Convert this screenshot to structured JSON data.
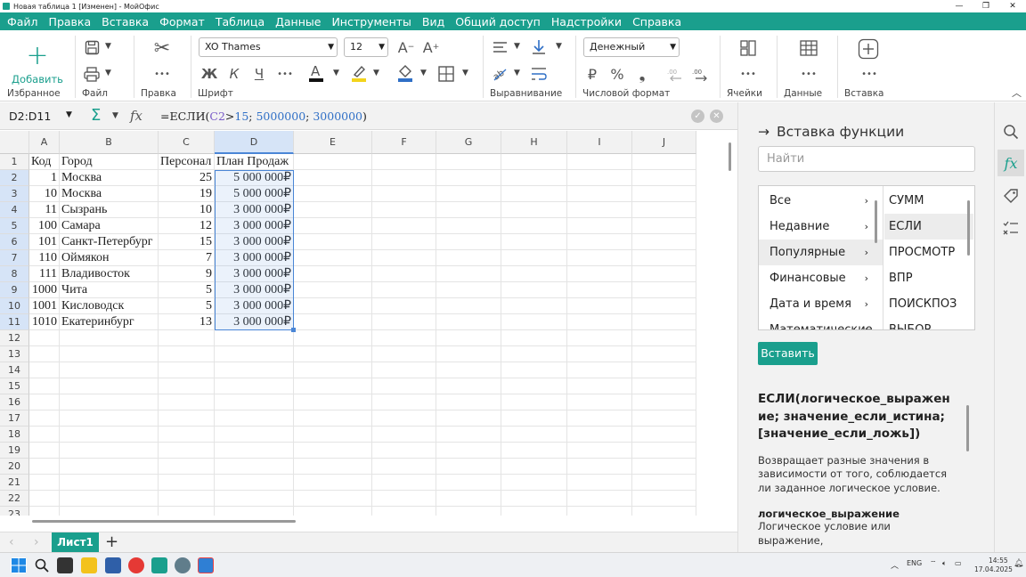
{
  "window": {
    "title": "Новая таблица 1 [Изменен] - МойОфис",
    "controls": [
      "—",
      "❐",
      "✕"
    ]
  },
  "menu": [
    "Файл",
    "Правка",
    "Вставка",
    "Формат",
    "Таблица",
    "Данные",
    "Инструменты",
    "Вид",
    "Общий доступ",
    "Надстройки",
    "Справка"
  ],
  "ribbon": {
    "add_label": "Добавить",
    "groups": {
      "favorites": "Избранное",
      "file": "Файл",
      "edit": "Правка",
      "font": "Шрифт",
      "align": "Выравнивание",
      "numfmt": "Числовой формат",
      "cells": "Ячейки",
      "data": "Данные",
      "insert": "Вставка"
    },
    "font_name": "XO Thames",
    "font_size": "12",
    "number_format": "Денежный",
    "bold_glyph": "Ж",
    "italic_glyph": "К",
    "underline_glyph": "Ч",
    "currency_glyph": "₽",
    "percent_glyph": "%",
    "more_glyph": "•••"
  },
  "formula_bar": {
    "cell_ref": "D2:D11",
    "fx": "fx",
    "formula_parts": [
      "=ЕСЛИ(",
      "C2",
      ">",
      "15",
      "; ",
      "5000000",
      "; ",
      "3000000",
      ")"
    ]
  },
  "sheet": {
    "columns": [
      "A",
      "B",
      "C",
      "D",
      "E",
      "F",
      "G",
      "H",
      "I",
      "J"
    ],
    "rows": [
      "1",
      "2",
      "3",
      "4",
      "5",
      "6",
      "7",
      "8",
      "9",
      "10",
      "11",
      "12",
      "13",
      "14",
      "15",
      "16",
      "17",
      "18",
      "19",
      "20",
      "21",
      "22",
      "23"
    ],
    "header": [
      "Код",
      "Город",
      "Персонал",
      "План Продаж"
    ],
    "data": [
      [
        "1",
        "Москва",
        "25",
        "5 000 000₽"
      ],
      [
        "10",
        "Москва",
        "19",
        "5 000 000₽"
      ],
      [
        "11",
        "Сызрань",
        "10",
        "3 000 000₽"
      ],
      [
        "100",
        "Самара",
        "12",
        "3 000 000₽"
      ],
      [
        "101",
        "Санкт-Петербург",
        "15",
        "3 000 000₽"
      ],
      [
        "110",
        "Оймякон",
        "7",
        "3 000 000₽"
      ],
      [
        "111",
        "Владивосток",
        "9",
        "3 000 000₽"
      ],
      [
        "1000",
        "Чита",
        "5",
        "3 000 000₽"
      ],
      [
        "1001",
        "Кисловодск",
        "5",
        "3 000 000₽"
      ],
      [
        "1010",
        "Екатеринбург",
        "13",
        "3 000 000₽"
      ]
    ]
  },
  "tabs": {
    "active": "Лист1",
    "add": "+"
  },
  "panel": {
    "title": "Вставка функции",
    "search_placeholder": "Найти",
    "categories": [
      "Все",
      "Недавние",
      "Популярные",
      "Финансовые",
      "Дата и время",
      "Математические"
    ],
    "selected_category": "Популярные",
    "functions": [
      "СУММ",
      "ЕСЛИ",
      "ПРОСМОТР",
      "ВПР",
      "ПОИСКПОЗ",
      "ВЫБОР"
    ],
    "selected_function": "ЕСЛИ",
    "insert_label": "Вставить",
    "signature": "ЕСЛИ(логическое_выражение; значение_если_истина; [значение_если_ложь])",
    "description": "Возвращает разные значения в зависимости от того, соблюдается ли заданное логическое условие.",
    "arg_name": "логическое_выражение",
    "arg_desc": "Логическое условие или выражение,"
  },
  "taskbar": {
    "lang": "ENG",
    "time": "14:55",
    "date": "17.04.2025"
  },
  "colors": {
    "accent": "#1a9f8d",
    "selection": "#4a86d6"
  }
}
